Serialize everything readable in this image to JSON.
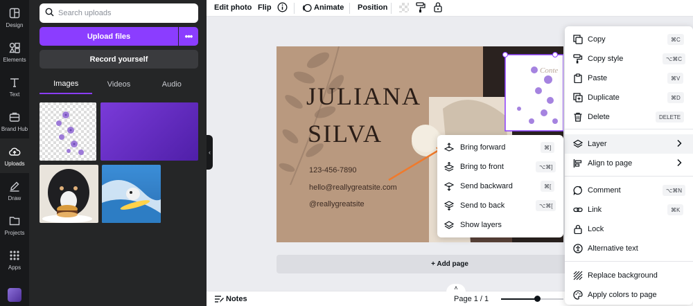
{
  "rail": {
    "items": [
      {
        "label": "Design",
        "icon": "design-icon"
      },
      {
        "label": "Elements",
        "icon": "elements-icon"
      },
      {
        "label": "Text",
        "icon": "text-icon"
      },
      {
        "label": "Brand Hub",
        "icon": "brand-hub-icon"
      },
      {
        "label": "Uploads",
        "icon": "uploads-icon"
      },
      {
        "label": "Draw",
        "icon": "draw-icon"
      },
      {
        "label": "Projects",
        "icon": "projects-icon"
      },
      {
        "label": "Apps",
        "icon": "apps-icon"
      }
    ],
    "active": "Uploads"
  },
  "panel": {
    "search_placeholder": "Search uploads",
    "upload_label": "Upload files",
    "more_label": "•••",
    "record_label": "Record yourself",
    "tabs": [
      "Images",
      "Videos",
      "Audio"
    ],
    "active_tab": "Images"
  },
  "toolbar": {
    "edit_photo": "Edit photo",
    "flip": "Flip",
    "animate": "Animate",
    "position": "Position"
  },
  "card": {
    "name_line1": "JULIANA",
    "name_line2": "SILVA",
    "phone": "123-456-7890",
    "email": "hello@reallygreatsite.com",
    "handle": "@reallygreatsite",
    "side_text": "Conte"
  },
  "canvas": {
    "add_page": "+ Add page"
  },
  "bottom": {
    "notes": "Notes",
    "page_indicator": "Page 1 / 1"
  },
  "context_menu": {
    "items": [
      {
        "label": "Copy",
        "shortcut": "⌘C",
        "icon": "copy-icon"
      },
      {
        "label": "Copy style",
        "shortcut": "⌥⌘C",
        "icon": "paint-roller-icon"
      },
      {
        "label": "Paste",
        "shortcut": "⌘V",
        "icon": "paste-icon"
      },
      {
        "label": "Duplicate",
        "shortcut": "⌘D",
        "icon": "duplicate-icon"
      },
      {
        "label": "Delete",
        "shortcut": "DELETE",
        "icon": "trash-icon"
      },
      {
        "label": "Layer",
        "shortcut": "",
        "icon": "layers-icon"
      },
      {
        "label": "Align to page",
        "shortcut": "",
        "icon": "align-icon"
      },
      {
        "label": "Comment",
        "shortcut": "⌥⌘N",
        "icon": "comment-icon"
      },
      {
        "label": "Link",
        "shortcut": "⌘K",
        "icon": "link-icon"
      },
      {
        "label": "Lock",
        "shortcut": "",
        "icon": "lock-icon"
      },
      {
        "label": "Alternative text",
        "shortcut": "",
        "icon": "accessibility-icon"
      },
      {
        "label": "Replace background",
        "shortcut": "",
        "icon": "hatch-icon"
      },
      {
        "label": "Apply colors to page",
        "shortcut": "",
        "icon": "palette-icon"
      }
    ]
  },
  "layer_submenu": {
    "items": [
      {
        "label": "Bring forward",
        "shortcut": "⌘]",
        "icon": "bring-forward-icon"
      },
      {
        "label": "Bring to front",
        "shortcut": "⌥⌘]",
        "icon": "bring-to-front-icon"
      },
      {
        "label": "Send backward",
        "shortcut": "⌘[",
        "icon": "send-backward-icon"
      },
      {
        "label": "Send to back",
        "shortcut": "⌥⌘[",
        "icon": "send-to-back-icon"
      },
      {
        "label": "Show layers",
        "shortcut": "",
        "icon": "show-layers-icon"
      }
    ]
  },
  "colors": {
    "accent": "#8b3dff",
    "card_bg": "#b9997f",
    "arrow": "#f07a2c"
  }
}
